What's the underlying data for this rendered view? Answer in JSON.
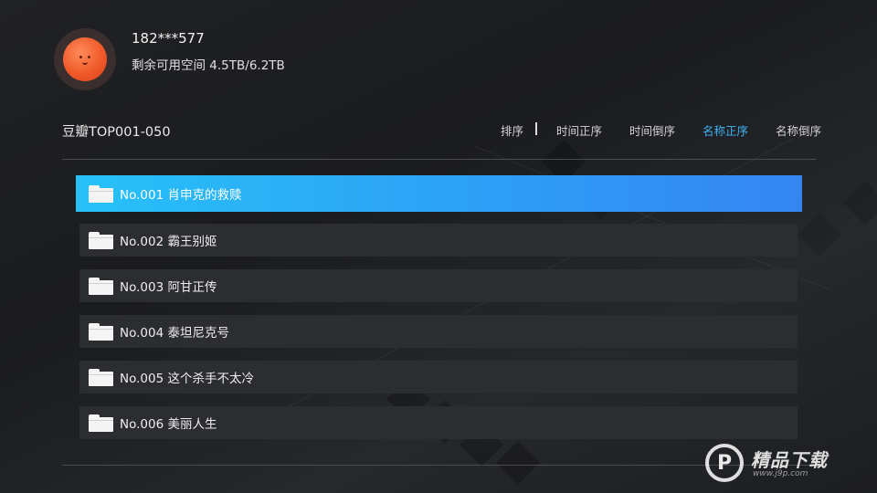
{
  "user": {
    "name": "182***577",
    "space": "剩余可用空间 4.5TB/6.2TB"
  },
  "folder": {
    "title": "豆瓣TOP001-050"
  },
  "sort": {
    "label": "排序",
    "options": [
      {
        "label": "时间正序",
        "active": false
      },
      {
        "label": "时间倒序",
        "active": false
      },
      {
        "label": "名称正序",
        "active": true
      },
      {
        "label": "名称倒序",
        "active": false
      }
    ]
  },
  "items": [
    {
      "label": "No.001 肖申克的救赎",
      "selected": true
    },
    {
      "label": "No.002 霸王别姬",
      "selected": false
    },
    {
      "label": "No.003 阿甘正传",
      "selected": false
    },
    {
      "label": "No.004 泰坦尼克号",
      "selected": false
    },
    {
      "label": "No.005 这个杀手不太冷",
      "selected": false
    },
    {
      "label": "No.006 美丽人生",
      "selected": false
    }
  ],
  "watermark": {
    "logo": "P",
    "text": "精品下载",
    "url": "www.j9p.com"
  },
  "colors": {
    "accent": "#3fb4f5",
    "selected_start": "#27c1f8",
    "selected_end": "#3585f1",
    "row_bg": "#2c2d30"
  },
  "icons": {
    "folder": "folder-icon",
    "avatar": "orange-avatar"
  }
}
